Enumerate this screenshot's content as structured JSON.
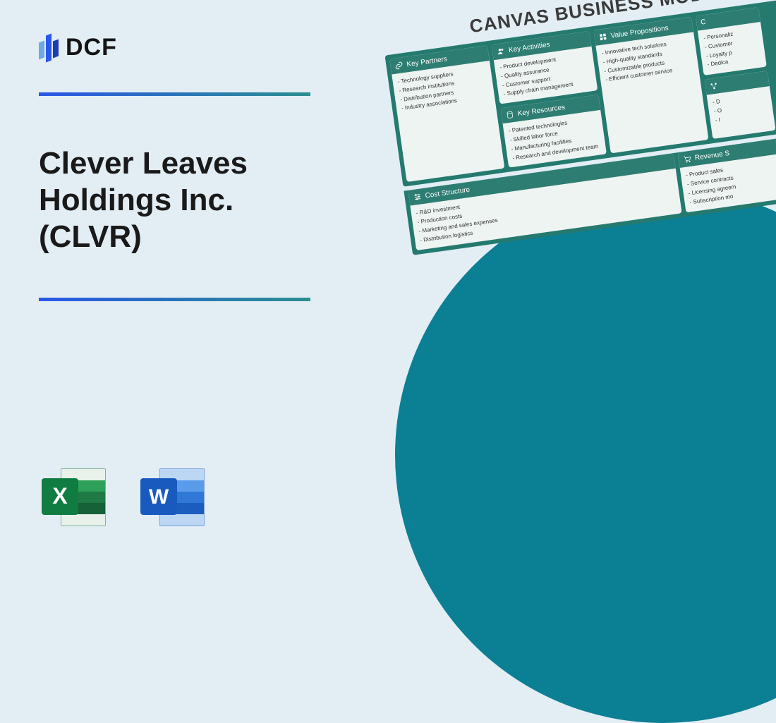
{
  "logo": {
    "text": "DCF"
  },
  "title": "Clever Leaves Holdings Inc. (CLVR)",
  "canvas": {
    "heading": "CANVAS BUSINESS MODEL",
    "key_partners": {
      "label": "Key Partners",
      "items": [
        "Technology suppliers",
        "Research institutions",
        "Distribution partners",
        "Industry associations"
      ]
    },
    "key_activities": {
      "label": "Key Activities",
      "items": [
        "Product development",
        "Quality assurance",
        "Customer support",
        "Supply chain management"
      ]
    },
    "key_resources": {
      "label": "Key Resources",
      "items": [
        "Patented technologies",
        "Skilled labor force",
        "Manufacturing facilities",
        "Research and development team"
      ]
    },
    "value_propositions": {
      "label": "Value Propositions",
      "items": [
        "Innovative tech solutions",
        "High-quality standards",
        "Customizable products",
        "Efficient customer service"
      ]
    },
    "customer_relations": {
      "label": "C",
      "items": [
        "Personaliz",
        "Customer",
        "Loyalty p",
        "Dedica"
      ]
    },
    "channels": {
      "label": "",
      "items": [
        "D",
        "O",
        "I"
      ]
    },
    "cost_structure": {
      "label": "Cost Structure",
      "items": [
        "R&D investment",
        "Production costs",
        "Marketing and sales expenses",
        "Distribution logistics"
      ]
    },
    "revenue": {
      "label": "Revenue S",
      "items": [
        "Product sales",
        "Service contracts",
        "Licensing agreem",
        "Subscription mo"
      ]
    }
  }
}
